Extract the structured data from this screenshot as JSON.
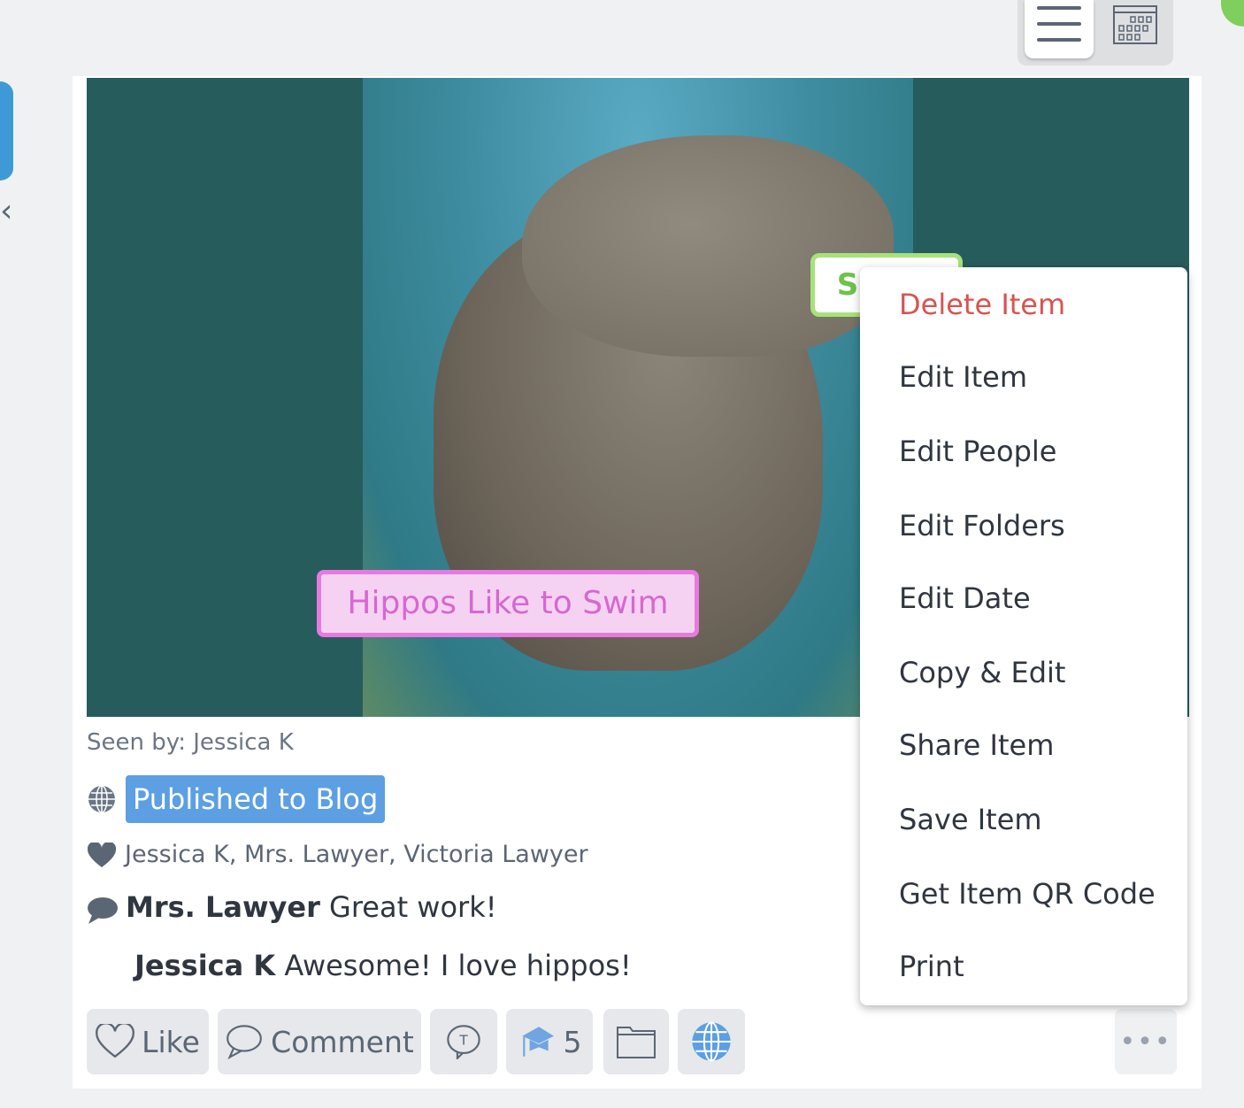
{
  "image_labels": {
    "snout": "Snout",
    "caption": "Hippos Like to Swim"
  },
  "nav": {
    "back_icon": "chevron-left-icon",
    "menu_icon": "hamburger-icon",
    "calendar_icon": "calendar-icon"
  },
  "post": {
    "seen_by": "Seen by: Jessica K",
    "published": "Published to Blog",
    "likers": "Jessica K, Mrs. Lawyer, Victoria Lawyer",
    "comments": [
      {
        "author": "Mrs. Lawyer",
        "text": "Great work!"
      },
      {
        "author": "Jessica K",
        "text": "Awesome! I love hippos!"
      }
    ]
  },
  "actions": {
    "like": "Like",
    "comment": "Comment",
    "skills_count": "5"
  },
  "context_menu": [
    "Delete Item",
    "Edit Item",
    "Edit People",
    "Edit Folders",
    "Edit Date",
    "Copy & Edit",
    "Share Item",
    "Save Item",
    "Get Item QR Code",
    "Print"
  ],
  "colors": {
    "accent": "#5c9fe2",
    "danger": "#d9534f",
    "teal": "#265c5c"
  }
}
